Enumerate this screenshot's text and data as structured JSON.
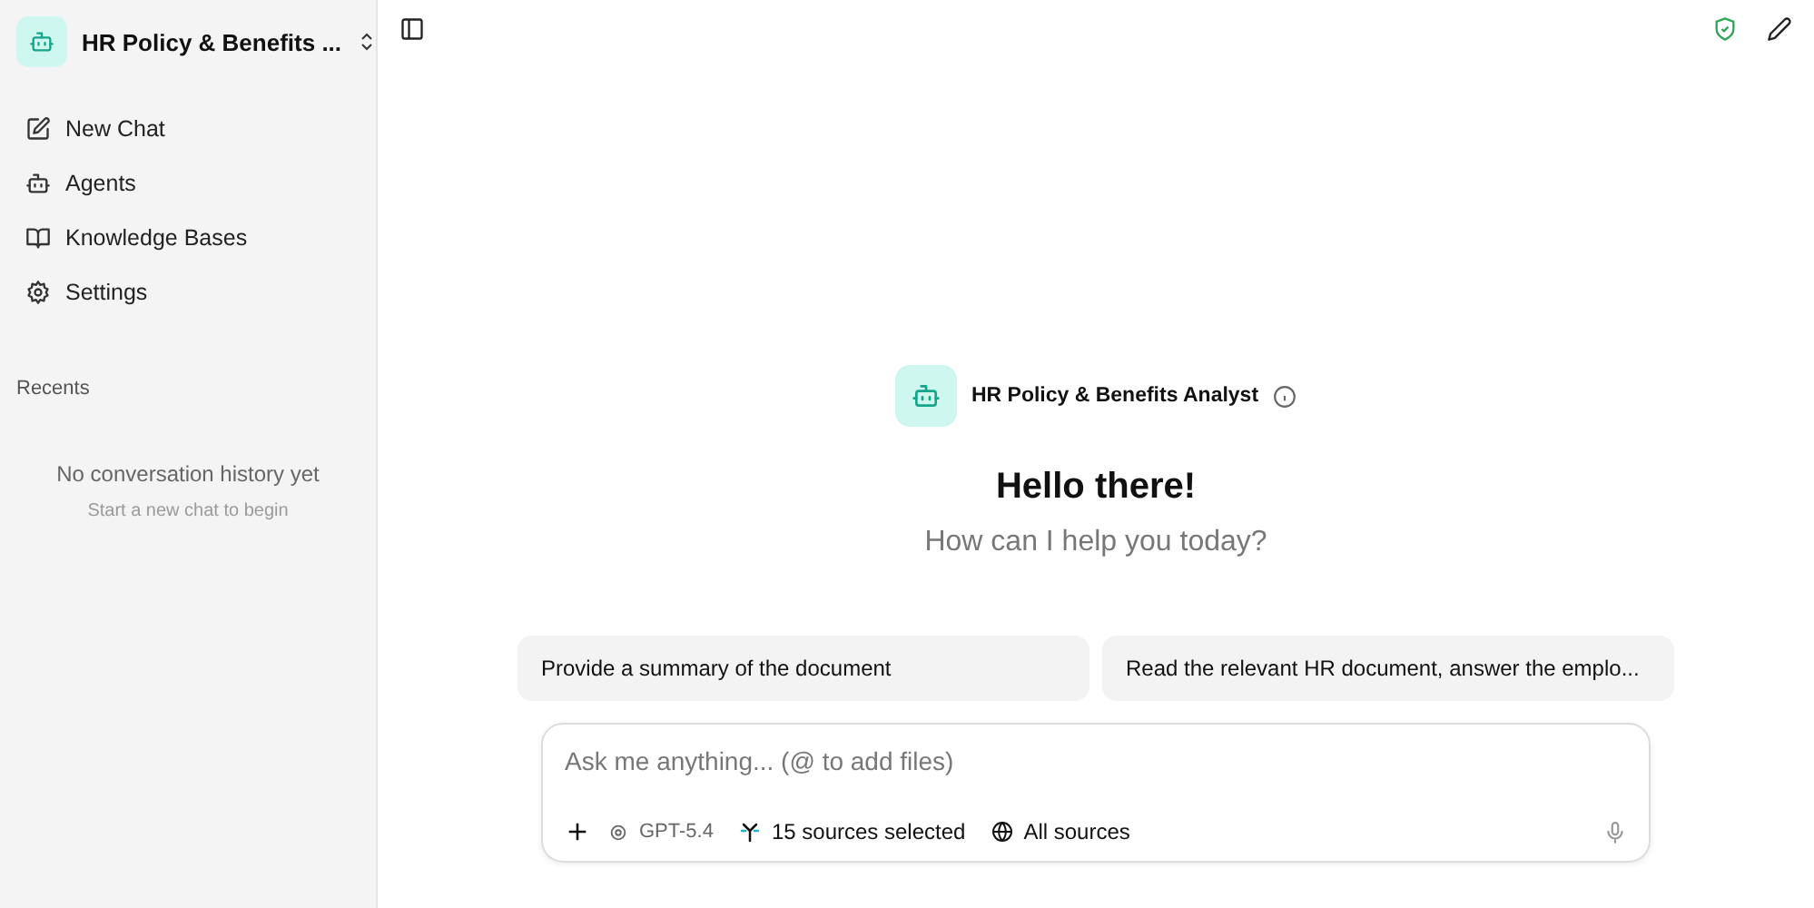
{
  "sidebar": {
    "agent_name": "HR Policy & Benefits ...",
    "items": [
      {
        "kind": "new-chat",
        "label": "New Chat"
      },
      {
        "kind": "agents",
        "label": "Agents"
      },
      {
        "kind": "knowledge",
        "label": "Knowledge Bases"
      },
      {
        "kind": "settings",
        "label": "Settings"
      }
    ],
    "recents": {
      "title": "Recents",
      "empty_title": "No conversation history yet",
      "empty_hint": "Start a new chat to begin"
    }
  },
  "agent": {
    "name": "HR Policy & Benefits Analyst"
  },
  "greeting": {
    "title": "Hello there!",
    "subtitle": "How can I help you today?"
  },
  "suggestions": [
    "Provide a summary of the document",
    "Read the relevant HR document, answer the emplo..."
  ],
  "composer": {
    "placeholder": "Ask me anything... (@ to add files)",
    "model": "GPT-5.4",
    "sources": "15 sources selected",
    "scope": "All sources"
  }
}
